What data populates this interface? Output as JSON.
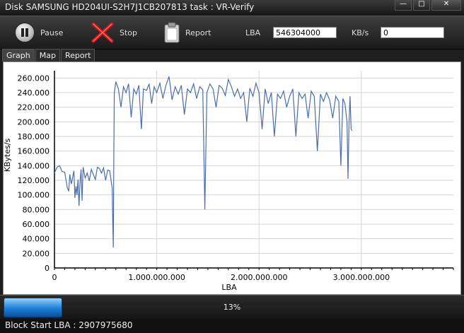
{
  "window": {
    "title": "Disk SAMSUNG HD204UI-S2H7J1CB207813   task : VR-Verify",
    "minimize": "—",
    "maximize": "□",
    "close": "✕"
  },
  "toolbar": {
    "pause_label": "Pause",
    "stop_label": "Stop",
    "report_label": "Report",
    "lba_label": "LBA",
    "lba_value": "546304000",
    "kbs_label": "KB/s",
    "kbs_value": "0"
  },
  "tabs": [
    {
      "label": "Graph",
      "active": true
    },
    {
      "label": "Map",
      "active": false
    },
    {
      "label": "Report",
      "active": false
    }
  ],
  "chart_data": {
    "type": "line",
    "xlabel": "LBA",
    "ylabel": "KBytes/s",
    "ylim": [
      0,
      270000
    ],
    "xlim": [
      0,
      3900000000
    ],
    "yticks": [
      "0",
      "20.000",
      "40.000",
      "60.000",
      "80.000",
      "100.000",
      "120.000",
      "140.000",
      "160.000",
      "180.000",
      "200.000",
      "220.000",
      "240.000",
      "260.000"
    ],
    "xticks": [
      "0",
      "1.000.000.000",
      "2.000.000.000",
      "3.000.000.000"
    ],
    "series": [
      {
        "color": "#4a6ea9",
        "points": [
          [
            0,
            130000
          ],
          [
            25000000,
            138000
          ],
          [
            50000000,
            140000
          ],
          [
            75000000,
            132000
          ],
          [
            100000000,
            131000
          ],
          [
            125000000,
            110000
          ],
          [
            140000000,
            105000
          ],
          [
            150000000,
            128000
          ],
          [
            165000000,
            115000
          ],
          [
            175000000,
            122000
          ],
          [
            190000000,
            133000
          ],
          [
            200000000,
            96000
          ],
          [
            210000000,
            112000
          ],
          [
            220000000,
            100000
          ],
          [
            230000000,
            121000
          ],
          [
            240000000,
            85000
          ],
          [
            250000000,
            118000
          ],
          [
            260000000,
            135000
          ],
          [
            270000000,
            92000
          ],
          [
            280000000,
            138000
          ],
          [
            300000000,
            123000
          ],
          [
            320000000,
            130000
          ],
          [
            340000000,
            119000
          ],
          [
            360000000,
            135000
          ],
          [
            380000000,
            128000
          ],
          [
            400000000,
            121000
          ],
          [
            420000000,
            138000
          ],
          [
            440000000,
            136000
          ],
          [
            460000000,
            130000
          ],
          [
            480000000,
            137000
          ],
          [
            500000000,
            120000
          ],
          [
            520000000,
            134000
          ],
          [
            540000000,
            133000
          ],
          [
            555000000,
            118000
          ],
          [
            565000000,
            109000
          ],
          [
            570000000,
            62000
          ],
          [
            575000000,
            28000
          ],
          [
            580000000,
            150000
          ],
          [
            585000000,
            240000
          ],
          [
            600000000,
            255000
          ],
          [
            625000000,
            245000
          ],
          [
            650000000,
            220000
          ],
          [
            675000000,
            248000
          ],
          [
            700000000,
            240000
          ],
          [
            725000000,
            252000
          ],
          [
            750000000,
            206000
          ],
          [
            775000000,
            245000
          ],
          [
            800000000,
            238000
          ],
          [
            825000000,
            250000
          ],
          [
            850000000,
            190000
          ],
          [
            870000000,
            245000
          ],
          [
            900000000,
            243000
          ],
          [
            925000000,
            252000
          ],
          [
            950000000,
            225000
          ],
          [
            975000000,
            248000
          ],
          [
            1000000000,
            240000
          ],
          [
            1030000000,
            253000
          ],
          [
            1060000000,
            232000
          ],
          [
            1090000000,
            250000
          ],
          [
            1120000000,
            262000
          ],
          [
            1150000000,
            230000
          ],
          [
            1180000000,
            248000
          ],
          [
            1210000000,
            238000
          ],
          [
            1240000000,
            250000
          ],
          [
            1270000000,
            210000
          ],
          [
            1300000000,
            245000
          ],
          [
            1330000000,
            240000
          ],
          [
            1360000000,
            252000
          ],
          [
            1390000000,
            232000
          ],
          [
            1420000000,
            248000
          ],
          [
            1450000000,
            244000
          ],
          [
            1470000000,
            80000
          ],
          [
            1490000000,
            240000
          ],
          [
            1520000000,
            252000
          ],
          [
            1550000000,
            245000
          ],
          [
            1580000000,
            220000
          ],
          [
            1610000000,
            250000
          ],
          [
            1640000000,
            246000
          ],
          [
            1670000000,
            236000
          ],
          [
            1700000000,
            258000
          ],
          [
            1730000000,
            248000
          ],
          [
            1760000000,
            235000
          ],
          [
            1790000000,
            245000
          ],
          [
            1820000000,
            232000
          ],
          [
            1850000000,
            240000
          ],
          [
            1880000000,
            200000
          ],
          [
            1910000000,
            246000
          ],
          [
            1940000000,
            235000
          ],
          [
            1970000000,
            253000
          ],
          [
            2000000000,
            240000
          ],
          [
            2030000000,
            190000
          ],
          [
            2060000000,
            245000
          ],
          [
            2090000000,
            225000
          ],
          [
            2120000000,
            240000
          ],
          [
            2150000000,
            180000
          ],
          [
            2180000000,
            238000
          ],
          [
            2210000000,
            232000
          ],
          [
            2240000000,
            242000
          ],
          [
            2270000000,
            220000
          ],
          [
            2300000000,
            235000
          ],
          [
            2330000000,
            245000
          ],
          [
            2360000000,
            180000
          ],
          [
            2390000000,
            240000
          ],
          [
            2420000000,
            232000
          ],
          [
            2450000000,
            238000
          ],
          [
            2480000000,
            205000
          ],
          [
            2510000000,
            242000
          ],
          [
            2540000000,
            235000
          ],
          [
            2570000000,
            160000
          ],
          [
            2600000000,
            238000
          ],
          [
            2630000000,
            228000
          ],
          [
            2660000000,
            240000
          ],
          [
            2690000000,
            230000
          ],
          [
            2720000000,
            205000
          ],
          [
            2750000000,
            235000
          ],
          [
            2780000000,
            228000
          ],
          [
            2800000000,
            140000
          ],
          [
            2820000000,
            232000
          ],
          [
            2840000000,
            225000
          ],
          [
            2860000000,
            200000
          ],
          [
            2870000000,
            122000
          ],
          [
            2880000000,
            200000
          ],
          [
            2890000000,
            235000
          ],
          [
            2900000000,
            190000
          ],
          [
            2910000000,
            188000
          ]
        ]
      }
    ]
  },
  "progress": {
    "fraction": 0.13,
    "text": "13%"
  },
  "statusbar": {
    "text": "Block Start LBA : 2907975680"
  }
}
